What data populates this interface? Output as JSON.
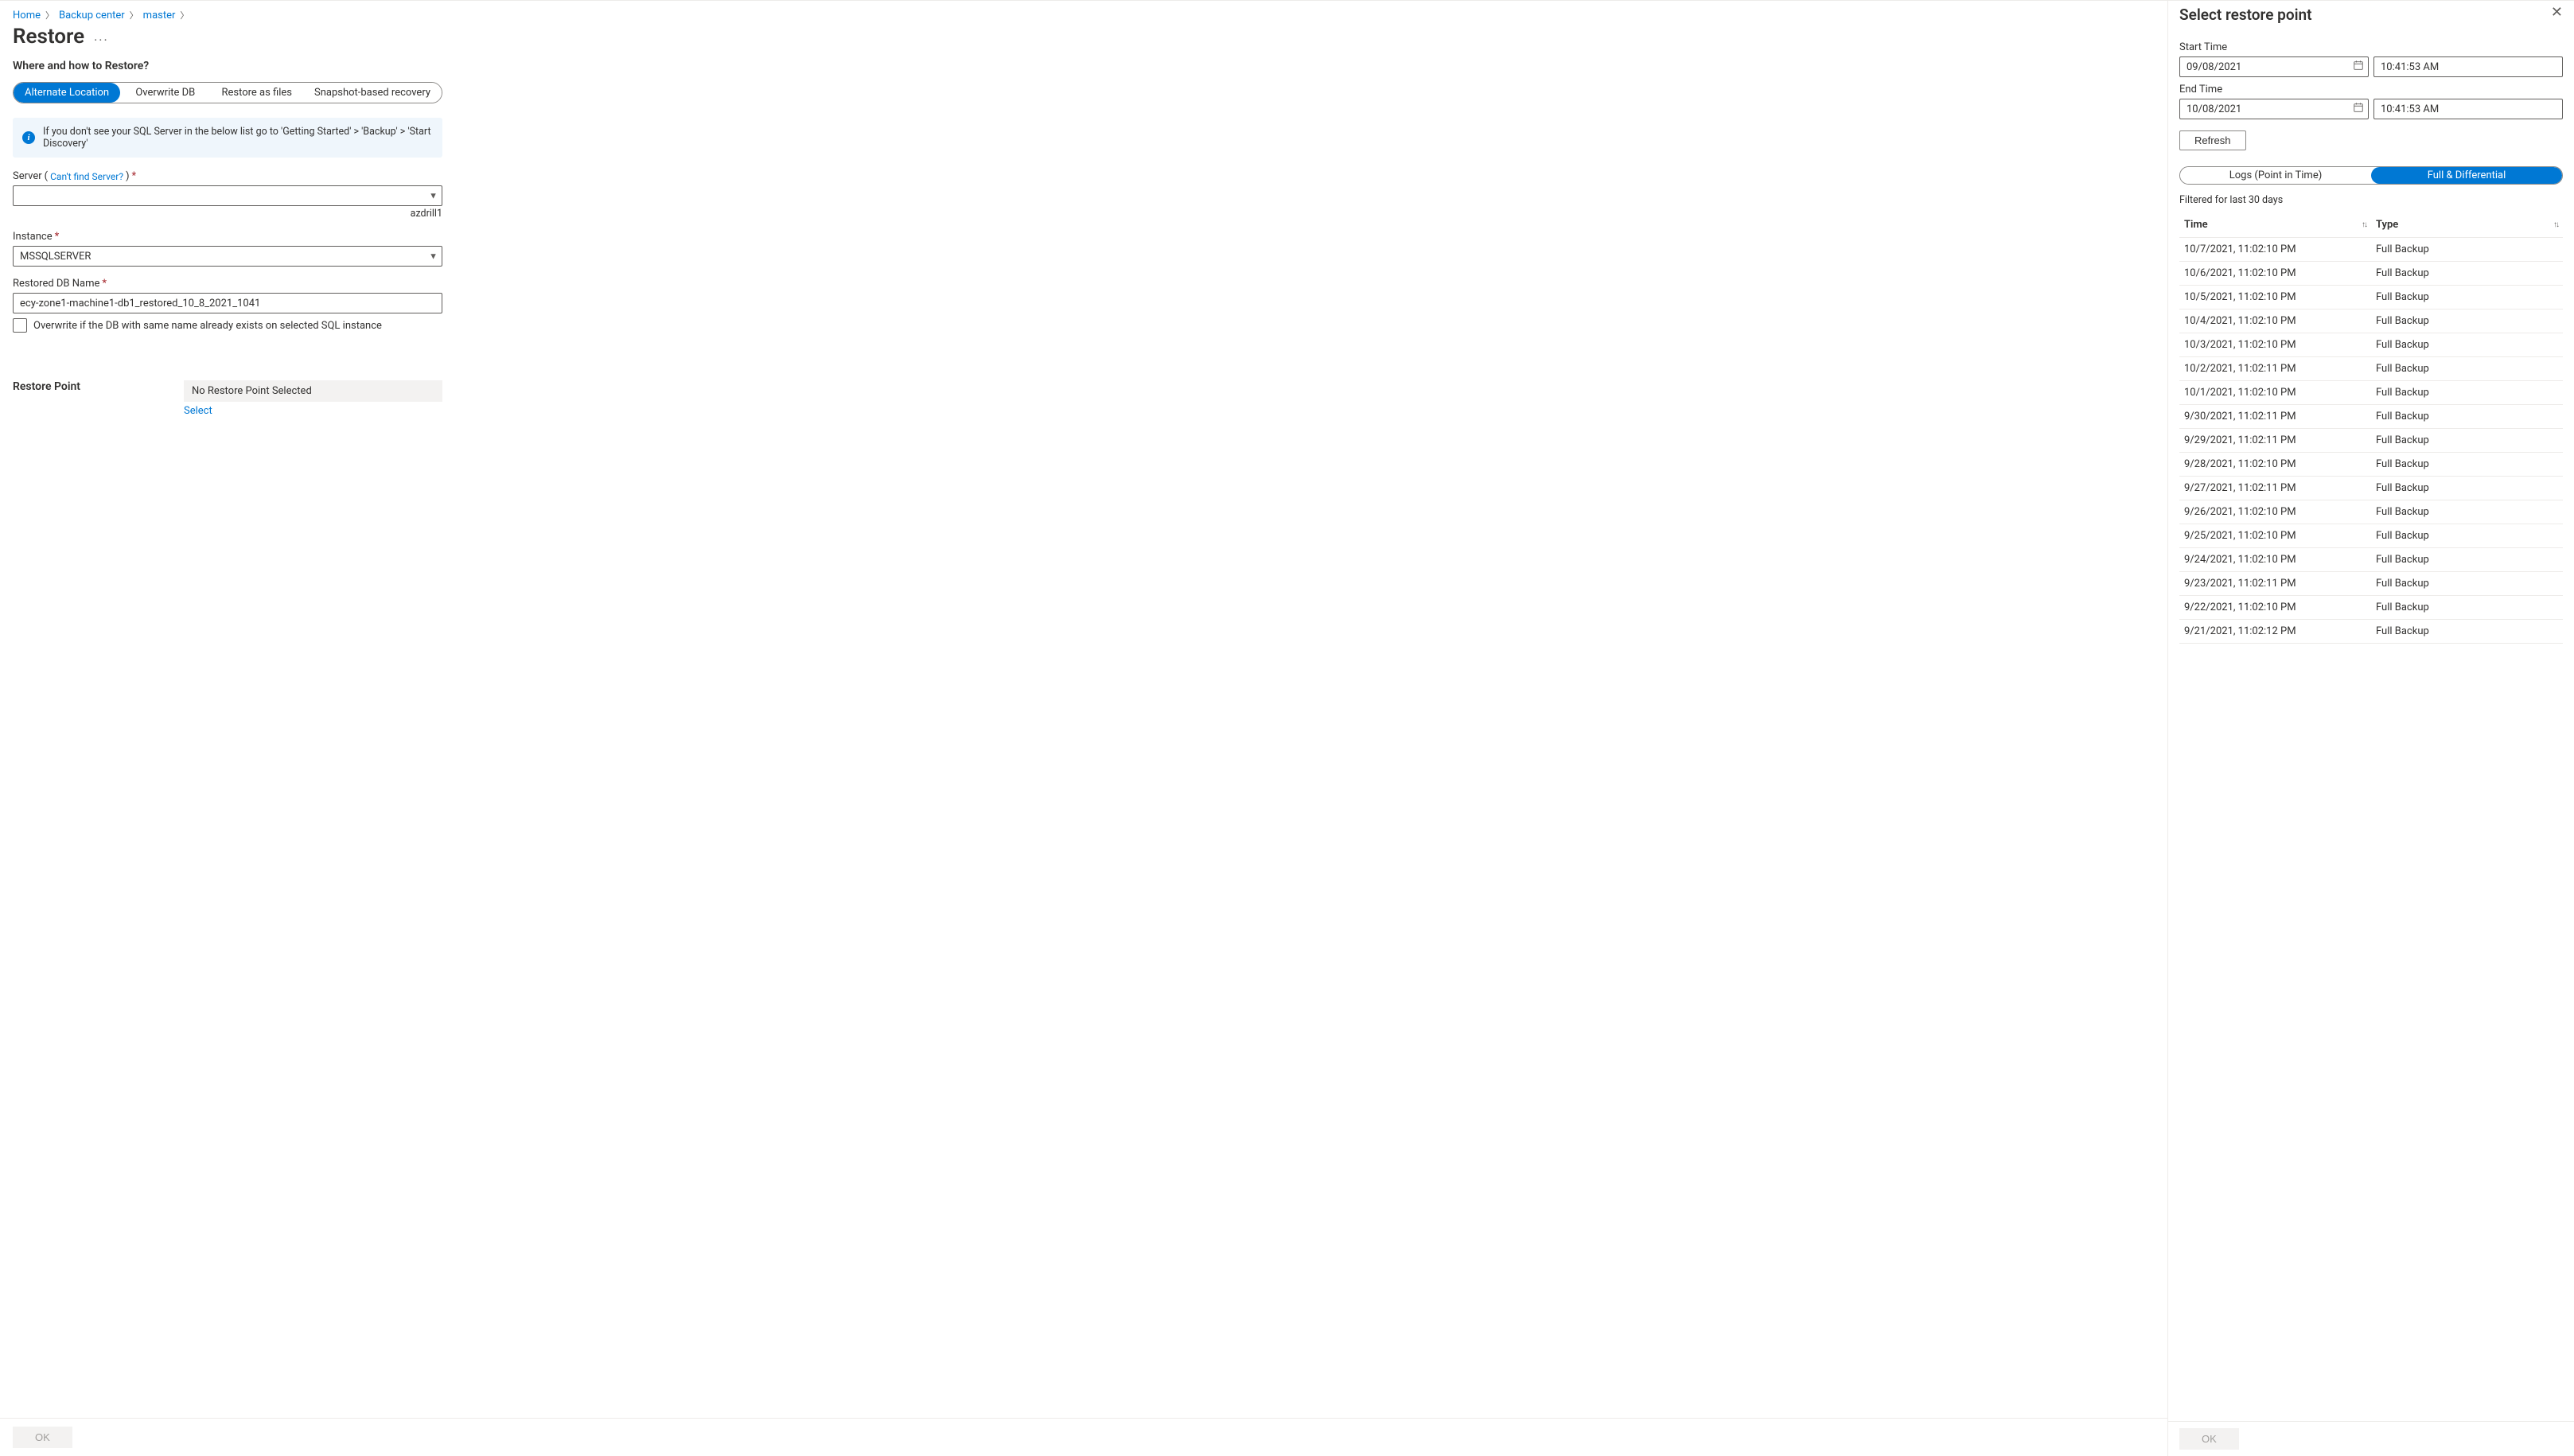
{
  "breadcrumb": {
    "items": [
      {
        "label": "Home"
      },
      {
        "label": "Backup center"
      },
      {
        "label": "master"
      }
    ]
  },
  "page": {
    "title": "Restore",
    "section1": "Where and how to Restore?",
    "restore_point_label": "Restore Point"
  },
  "mode_pills": [
    "Alternate Location",
    "Overwrite DB",
    "Restore as files",
    "Snapshot-based recovery"
  ],
  "info_banner": "If you don't see your SQL Server in the below list go to 'Getting Started' > 'Backup' > 'Start Discovery'",
  "fields": {
    "server_label": "Server",
    "server_help": "Can't find Server?",
    "server_value": "",
    "server_hint_right": "azdrill1",
    "instance_label": "Instance",
    "instance_value": "MSSQLSERVER",
    "restored_name_label": "Restored DB Name",
    "restored_name_value": "ecy-zone1-machine1-db1_restored_10_8_2021_1041",
    "overwrite_label": "Overwrite if the DB with same name already exists on selected SQL instance",
    "restore_point_value": "No Restore Point Selected",
    "select_link": "Select"
  },
  "main_footer": {
    "ok": "OK"
  },
  "blade": {
    "title": "Select restore point",
    "start_time_label": "Start Time",
    "end_time_label": "End Time",
    "start_date": "09/08/2021",
    "start_time": "10:41:53 AM",
    "end_date": "10/08/2021",
    "end_time": "10:41:53 AM",
    "refresh": "Refresh",
    "tabs": [
      "Logs (Point in Time)",
      "Full & Differential"
    ],
    "filter_note": "Filtered for last 30 days",
    "cols": {
      "time": "Time",
      "type": "Type"
    },
    "rows": [
      {
        "time": "10/7/2021, 11:02:10 PM",
        "type": "Full Backup"
      },
      {
        "time": "10/6/2021, 11:02:10 PM",
        "type": "Full Backup"
      },
      {
        "time": "10/5/2021, 11:02:10 PM",
        "type": "Full Backup"
      },
      {
        "time": "10/4/2021, 11:02:10 PM",
        "type": "Full Backup"
      },
      {
        "time": "10/3/2021, 11:02:10 PM",
        "type": "Full Backup"
      },
      {
        "time": "10/2/2021, 11:02:11 PM",
        "type": "Full Backup"
      },
      {
        "time": "10/1/2021, 11:02:10 PM",
        "type": "Full Backup"
      },
      {
        "time": "9/30/2021, 11:02:11 PM",
        "type": "Full Backup"
      },
      {
        "time": "9/29/2021, 11:02:11 PM",
        "type": "Full Backup"
      },
      {
        "time": "9/28/2021, 11:02:10 PM",
        "type": "Full Backup"
      },
      {
        "time": "9/27/2021, 11:02:11 PM",
        "type": "Full Backup"
      },
      {
        "time": "9/26/2021, 11:02:10 PM",
        "type": "Full Backup"
      },
      {
        "time": "9/25/2021, 11:02:10 PM",
        "type": "Full Backup"
      },
      {
        "time": "9/24/2021, 11:02:10 PM",
        "type": "Full Backup"
      },
      {
        "time": "9/23/2021, 11:02:11 PM",
        "type": "Full Backup"
      },
      {
        "time": "9/22/2021, 11:02:10 PM",
        "type": "Full Backup"
      },
      {
        "time": "9/21/2021, 11:02:12 PM",
        "type": "Full Backup"
      }
    ],
    "ok": "OK"
  }
}
